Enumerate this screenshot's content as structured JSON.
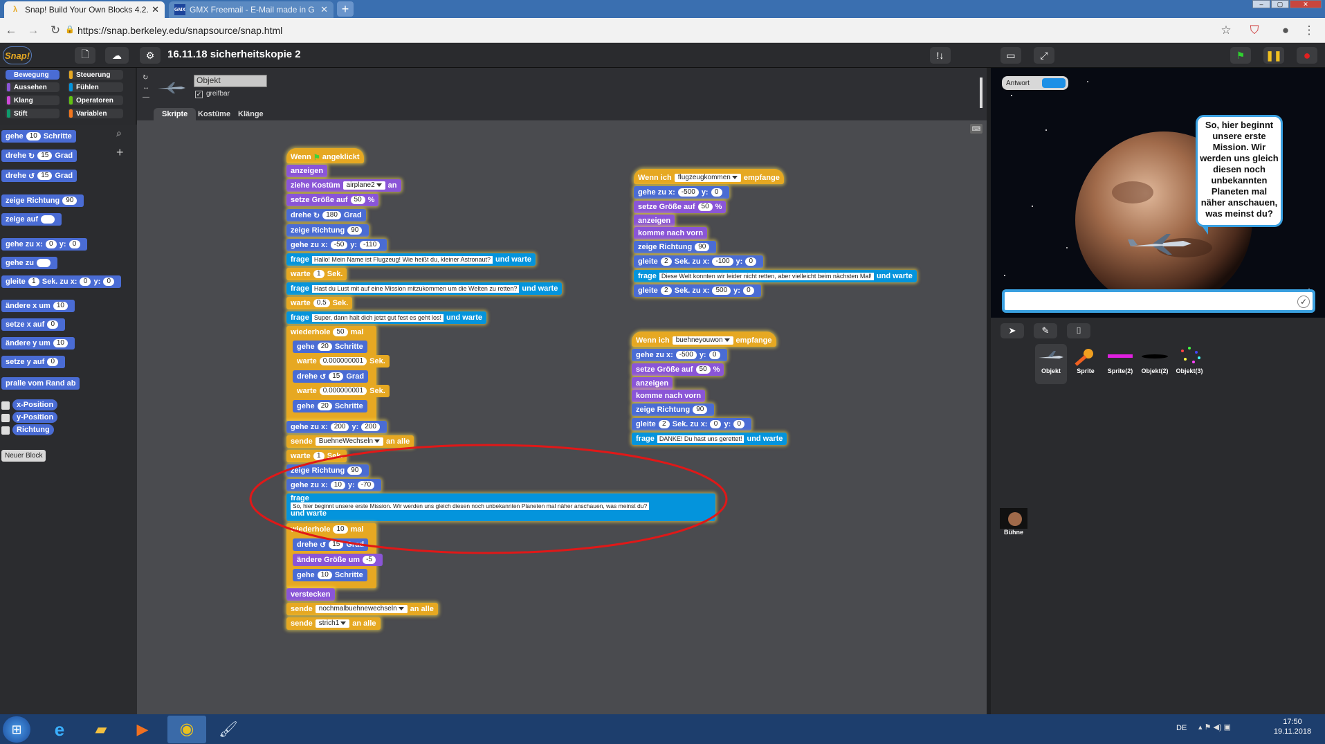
{
  "browser": {
    "tabs": [
      {
        "title": "Snap! Build Your Own Blocks 4.2.",
        "icon": "snap-lambda-icon"
      },
      {
        "title": "GMX Freemail - E-Mail made in G",
        "icon": "gmx-icon"
      }
    ],
    "url": "https://snap.berkeley.edu/snapsource/snap.html"
  },
  "snap": {
    "logo": "Snap!",
    "project_title": "16.11.18 sicherheitskopie 2",
    "categories": [
      "Bewegung",
      "Steuerung",
      "Aussehen",
      "Fühlen",
      "Klang",
      "Operatoren",
      "Stift",
      "Variablen"
    ],
    "palette": {
      "gehe": "gehe",
      "gehe_steps": "10",
      "schritte": "Schritte",
      "drehe": "drehe",
      "drehe_deg": "15",
      "grad": "Grad",
      "zeige_richtung": "zeige Richtung",
      "dir_val": "90",
      "zeige_auf": "zeige auf",
      "gehe_zu_x": "gehe zu x:",
      "x0": "0",
      "y_label": "y:",
      "y0": "0",
      "gehe_zu": "gehe zu",
      "gleite": "gleite",
      "gleite_s": "1",
      "sek_zu_x": "Sek. zu x:",
      "aendere_x": "ändere x um",
      "ax_val": "10",
      "setze_x": "setze x auf",
      "sx_val": "0",
      "aendere_y": "ändere y um",
      "ay_val": "10",
      "setze_y": "setze y auf",
      "sy_val": "0",
      "pralle": "pralle vom Rand ab",
      "reporters": [
        "x-Position",
        "y-Position",
        "Richtung"
      ],
      "neuer_block": "Neuer Block"
    },
    "sprite": {
      "name": "Objekt",
      "draggable_label": "greifbar"
    },
    "editor_tabs": [
      "Skripte",
      "Kostüme",
      "Klänge"
    ],
    "answer_toggle": "Antwort",
    "bubble_text": "So, hier beginnt unsere erste Mission. Wir werden uns gleich diesen noch unbekannten Planeten mal näher anschauen, was meinst du?",
    "corral": [
      {
        "name": "Objekt"
      },
      {
        "name": "Sprite"
      },
      {
        "name": "Sprite(2)"
      },
      {
        "name": "Objekt(2)"
      },
      {
        "name": "Objekt(3)"
      }
    ],
    "stage_label": "Bühne"
  },
  "script1": {
    "wenn": "Wenn",
    "angeklickt": "angeklickt",
    "anzeigen": "anzeigen",
    "ziehe_kostuem": "ziehe Kostüm",
    "kostuem": "airplane2",
    "an": "an",
    "setze_groesse": "setze Größe auf",
    "groesse": "50",
    "pct": "%",
    "drehe": "drehe",
    "d180": "180",
    "grad": "Grad",
    "zeige_richtung": "zeige Richtung",
    "r90": "90",
    "gehe_zu_x": "gehe zu x:",
    "gx1": "-50",
    "y": "y:",
    "gy1": "-110",
    "frage": "frage",
    "und_warte": "und warte",
    "q1": "Hallo! Mein Name ist Flugzeug! Wie heißt du, kleiner Astronaut?",
    "warte": "warte",
    "w1": "1",
    "sek": "Sek.",
    "q2": "Hast du Lust mit auf eine Mission mitzukommen um die Welten zu retten?",
    "w2": "0.5",
    "q3": "Super, dann halt dich jetzt gut fest es geht los!",
    "wiederhole": "wiederhole",
    "rep1": "50",
    "mal": "mal",
    "gehe": "gehe",
    "s20": "20",
    "schritte": "Schritte",
    "wsmall": "0.000000001",
    "d15": "15",
    "gx2": "200",
    "gy2": "200",
    "sende": "sende",
    "msg1": "BuehneWechseln",
    "an_alle": "an alle",
    "w3": "1",
    "gx3": "10",
    "gy3": "-70",
    "q4": "So, hier beginnt unsere erste Mission. Wir werden uns gleich diesen noch unbekannten Planeten mal näher anschauen, was meinst du?",
    "rep2": "10",
    "d15b": "15",
    "aendere_groesse": "ändere Größe um",
    "ag": "-5",
    "s10": "10",
    "verstecken": "verstecken",
    "msg2": "nochmalbuehnewechseln",
    "msg3": "strich1"
  },
  "script2": {
    "wenn_ich": "Wenn ich",
    "msg": "flugzeugkommen",
    "empfange": "empfange",
    "gehe_zu_x": "gehe zu x:",
    "x1": "-500",
    "y": "y:",
    "y1": "0",
    "setze_groesse": "setze Größe auf",
    "g": "50",
    "pct": "%",
    "anzeigen": "anzeigen",
    "komme_nach_vorn": "komme nach vorn",
    "zeige_richtung": "zeige Richtung",
    "r": "90",
    "gleite": "gleite",
    "s": "2",
    "sek_zu_x": "Sek. zu x:",
    "gx": "-100",
    "gy": "0",
    "frage": "frage",
    "und_warte": "und warte",
    "q": "Diese Welt konnten wir leider nicht retten, aber vielleicht beim nächsten Mal!",
    "gx2": "500",
    "gy2": "0"
  },
  "script3": {
    "wenn_ich": "Wenn ich",
    "msg": "buehneyouwon",
    "empfange": "empfange",
    "gehe_zu_x": "gehe zu x:",
    "x1": "-500",
    "y": "y:",
    "y1": "0",
    "setze_groesse": "setze Größe auf",
    "g": "50",
    "pct": "%",
    "anzeigen": "anzeigen",
    "komme_nach_vorn": "komme nach vorn",
    "zeige_richtung": "zeige Richtung",
    "r": "90",
    "gleite": "gleite",
    "s": "2",
    "sek_zu_x": "Sek. zu x:",
    "gx": "0",
    "gy": "0",
    "frage": "frage",
    "und_warte": "und warte",
    "q": "DANKE! Du hast uns gerettet!"
  },
  "taskbar": {
    "lang": "DE",
    "time": "17:50",
    "date": "19.11.2018"
  }
}
